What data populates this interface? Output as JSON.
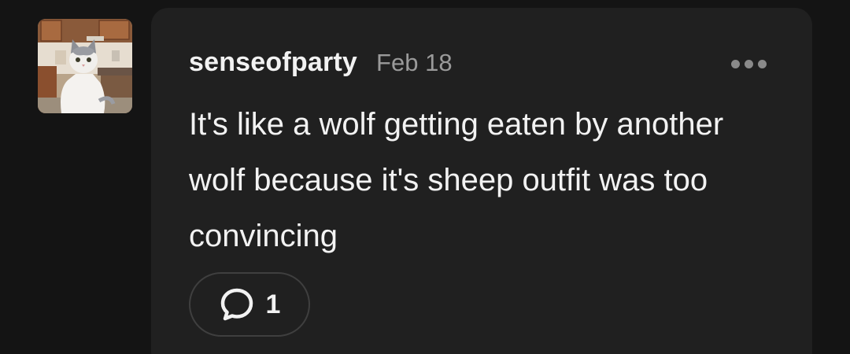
{
  "post": {
    "username": "senseofparty",
    "date": "Feb 18",
    "text": "It's like a wolf getting eaten by another wolf because it's sheep outfit was too convincing",
    "reply_count": "1",
    "more_icon": "more-horizontal-icon",
    "reply_icon": "speech-bubble-icon",
    "avatar_description": "photo avatar of a white and grey cat in a kitchen"
  },
  "theme": {
    "background": "#141414",
    "card": "#202020",
    "text": "#f2f2f2",
    "muted": "#9a9a9a",
    "border": "#3f3f3f"
  }
}
